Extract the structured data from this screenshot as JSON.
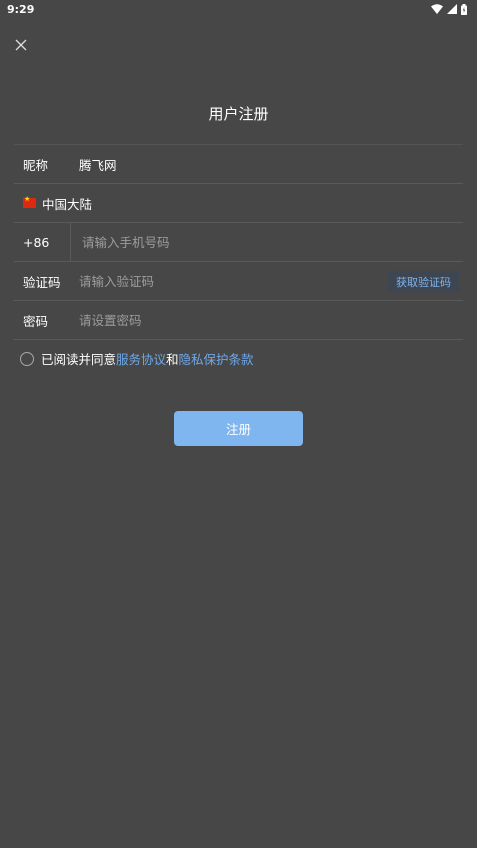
{
  "status_bar": {
    "time": "9:29",
    "icons": [
      "wifi-icon",
      "signal-icon",
      "battery-icon"
    ]
  },
  "header": {
    "close_icon": "close-icon",
    "title": "用户注册"
  },
  "form": {
    "nickname": {
      "label": "昵称",
      "value": "腾飞网"
    },
    "region": {
      "flag_icon": "china-flag-icon",
      "value": "中国大陆"
    },
    "phone": {
      "prefix": "+86",
      "placeholder": "请输入手机号码"
    },
    "verify_code": {
      "label": "验证码",
      "placeholder": "请输入验证码",
      "button": "获取验证码"
    },
    "password": {
      "label": "密码",
      "placeholder": "请设置密码"
    }
  },
  "agreement": {
    "prefix": "已阅读并同意",
    "service_link": "服务协议",
    "and": "和",
    "privacy_link": "隐私保护条款"
  },
  "register_button": "注册",
  "colors": {
    "background": "#474747",
    "accent": "#7fb6f0",
    "link": "#6fa8e8",
    "code_button_bg": "#3e4652"
  }
}
